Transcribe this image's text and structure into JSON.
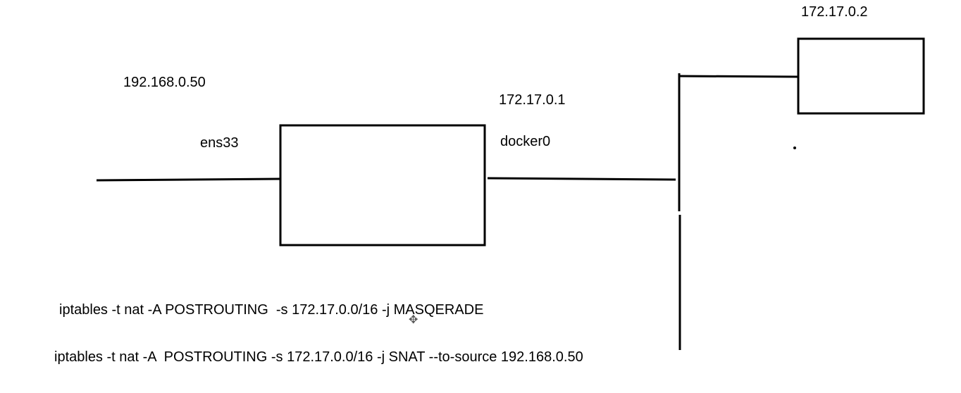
{
  "labels": {
    "host_ip": "192.168.0.50",
    "host_interface": "ens33",
    "bridge_ip": "172.17.0.1",
    "bridge_interface": "docker0",
    "container_ip": "172.17.0.2"
  },
  "commands": {
    "masquerade": "iptables -t nat -A POSTROUTING  -s 172.17.0.0/16 -j MASQERADE",
    "snat": "iptables -t nat -A  POSTROUTING -s 172.17.0.0/16 -j SNAT --to-source 192.168.0.50"
  },
  "colors": {
    "stroke": "#000000",
    "background": "#ffffff"
  },
  "icons": {
    "cursor": "move-cursor-icon"
  }
}
